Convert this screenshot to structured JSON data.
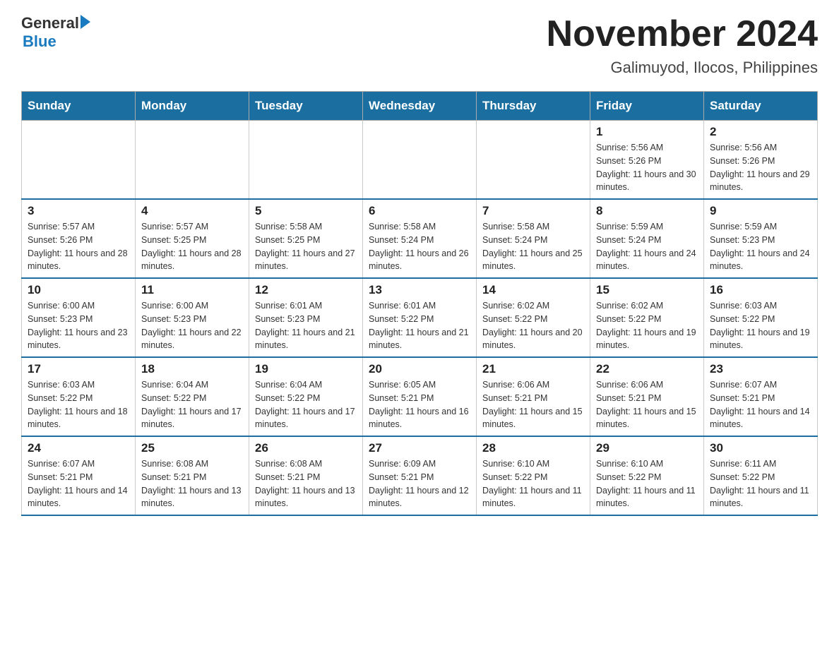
{
  "header": {
    "logo_general": "General",
    "logo_blue": "Blue",
    "title": "November 2024",
    "subtitle": "Galimuyod, Ilocos, Philippines"
  },
  "days_of_week": [
    "Sunday",
    "Monday",
    "Tuesday",
    "Wednesday",
    "Thursday",
    "Friday",
    "Saturday"
  ],
  "weeks": [
    [
      {
        "day": "",
        "info": ""
      },
      {
        "day": "",
        "info": ""
      },
      {
        "day": "",
        "info": ""
      },
      {
        "day": "",
        "info": ""
      },
      {
        "day": "",
        "info": ""
      },
      {
        "day": "1",
        "info": "Sunrise: 5:56 AM\nSunset: 5:26 PM\nDaylight: 11 hours and 30 minutes."
      },
      {
        "day": "2",
        "info": "Sunrise: 5:56 AM\nSunset: 5:26 PM\nDaylight: 11 hours and 29 minutes."
      }
    ],
    [
      {
        "day": "3",
        "info": "Sunrise: 5:57 AM\nSunset: 5:26 PM\nDaylight: 11 hours and 28 minutes."
      },
      {
        "day": "4",
        "info": "Sunrise: 5:57 AM\nSunset: 5:25 PM\nDaylight: 11 hours and 28 minutes."
      },
      {
        "day": "5",
        "info": "Sunrise: 5:58 AM\nSunset: 5:25 PM\nDaylight: 11 hours and 27 minutes."
      },
      {
        "day": "6",
        "info": "Sunrise: 5:58 AM\nSunset: 5:24 PM\nDaylight: 11 hours and 26 minutes."
      },
      {
        "day": "7",
        "info": "Sunrise: 5:58 AM\nSunset: 5:24 PM\nDaylight: 11 hours and 25 minutes."
      },
      {
        "day": "8",
        "info": "Sunrise: 5:59 AM\nSunset: 5:24 PM\nDaylight: 11 hours and 24 minutes."
      },
      {
        "day": "9",
        "info": "Sunrise: 5:59 AM\nSunset: 5:23 PM\nDaylight: 11 hours and 24 minutes."
      }
    ],
    [
      {
        "day": "10",
        "info": "Sunrise: 6:00 AM\nSunset: 5:23 PM\nDaylight: 11 hours and 23 minutes."
      },
      {
        "day": "11",
        "info": "Sunrise: 6:00 AM\nSunset: 5:23 PM\nDaylight: 11 hours and 22 minutes."
      },
      {
        "day": "12",
        "info": "Sunrise: 6:01 AM\nSunset: 5:23 PM\nDaylight: 11 hours and 21 minutes."
      },
      {
        "day": "13",
        "info": "Sunrise: 6:01 AM\nSunset: 5:22 PM\nDaylight: 11 hours and 21 minutes."
      },
      {
        "day": "14",
        "info": "Sunrise: 6:02 AM\nSunset: 5:22 PM\nDaylight: 11 hours and 20 minutes."
      },
      {
        "day": "15",
        "info": "Sunrise: 6:02 AM\nSunset: 5:22 PM\nDaylight: 11 hours and 19 minutes."
      },
      {
        "day": "16",
        "info": "Sunrise: 6:03 AM\nSunset: 5:22 PM\nDaylight: 11 hours and 19 minutes."
      }
    ],
    [
      {
        "day": "17",
        "info": "Sunrise: 6:03 AM\nSunset: 5:22 PM\nDaylight: 11 hours and 18 minutes."
      },
      {
        "day": "18",
        "info": "Sunrise: 6:04 AM\nSunset: 5:22 PM\nDaylight: 11 hours and 17 minutes."
      },
      {
        "day": "19",
        "info": "Sunrise: 6:04 AM\nSunset: 5:22 PM\nDaylight: 11 hours and 17 minutes."
      },
      {
        "day": "20",
        "info": "Sunrise: 6:05 AM\nSunset: 5:21 PM\nDaylight: 11 hours and 16 minutes."
      },
      {
        "day": "21",
        "info": "Sunrise: 6:06 AM\nSunset: 5:21 PM\nDaylight: 11 hours and 15 minutes."
      },
      {
        "day": "22",
        "info": "Sunrise: 6:06 AM\nSunset: 5:21 PM\nDaylight: 11 hours and 15 minutes."
      },
      {
        "day": "23",
        "info": "Sunrise: 6:07 AM\nSunset: 5:21 PM\nDaylight: 11 hours and 14 minutes."
      }
    ],
    [
      {
        "day": "24",
        "info": "Sunrise: 6:07 AM\nSunset: 5:21 PM\nDaylight: 11 hours and 14 minutes."
      },
      {
        "day": "25",
        "info": "Sunrise: 6:08 AM\nSunset: 5:21 PM\nDaylight: 11 hours and 13 minutes."
      },
      {
        "day": "26",
        "info": "Sunrise: 6:08 AM\nSunset: 5:21 PM\nDaylight: 11 hours and 13 minutes."
      },
      {
        "day": "27",
        "info": "Sunrise: 6:09 AM\nSunset: 5:21 PM\nDaylight: 11 hours and 12 minutes."
      },
      {
        "day": "28",
        "info": "Sunrise: 6:10 AM\nSunset: 5:22 PM\nDaylight: 11 hours and 11 minutes."
      },
      {
        "day": "29",
        "info": "Sunrise: 6:10 AM\nSunset: 5:22 PM\nDaylight: 11 hours and 11 minutes."
      },
      {
        "day": "30",
        "info": "Sunrise: 6:11 AM\nSunset: 5:22 PM\nDaylight: 11 hours and 11 minutes."
      }
    ]
  ]
}
